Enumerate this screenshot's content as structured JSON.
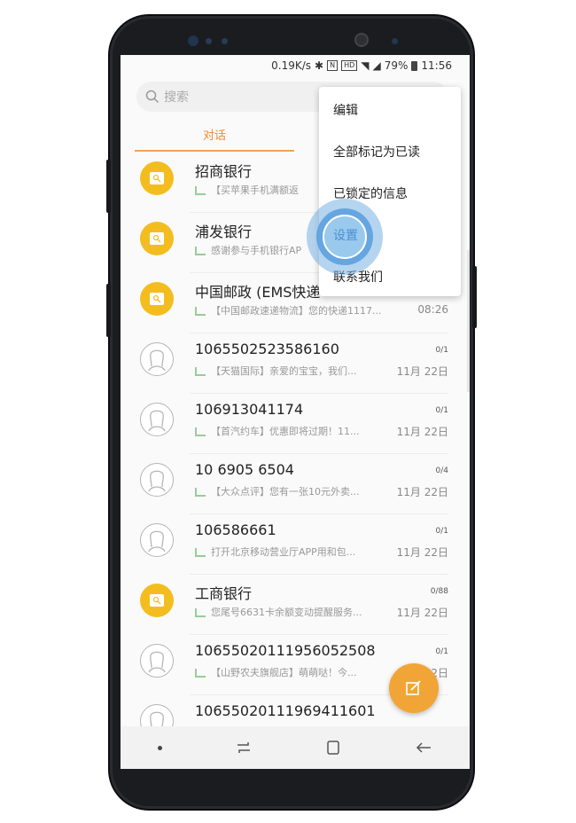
{
  "status_bar": {
    "speed": "0.19K/s",
    "hd": "HD",
    "battery": "79%",
    "time": "11:56"
  },
  "search": {
    "placeholder": "搜索"
  },
  "tabs": {
    "active": "对话"
  },
  "conversations": [
    {
      "name": "招商银行",
      "preview": "【买苹果手机满额返",
      "avatar": "bank",
      "count": "",
      "time": ""
    },
    {
      "name": "浦发银行",
      "preview": "感谢参与手机银行AP",
      "avatar": "bank",
      "count": "",
      "time": ""
    },
    {
      "name": "中国邮政 (EMS快递",
      "preview": "【中国邮政速递物流】您的快递1117...",
      "avatar": "bank",
      "count": "",
      "time": "08:26"
    },
    {
      "name": "1065502523586160",
      "preview": "【天猫国际】亲爱的宝宝，我们...",
      "avatar": "person",
      "count": "0/1",
      "time": "11月 22日"
    },
    {
      "name": "106913041174",
      "preview": "【首汽约车】优惠即将过期！11...",
      "avatar": "person",
      "count": "0/1",
      "time": "11月 22日"
    },
    {
      "name": "10 6905 6504",
      "preview": "【大众点评】您有一张10元外卖...",
      "avatar": "person",
      "count": "0/4",
      "time": "11月 22日"
    },
    {
      "name": "106586661",
      "preview": "打开北京移动营业厅APP用和包...",
      "avatar": "person",
      "count": "0/1",
      "time": "11月 22日"
    },
    {
      "name": "工商银行",
      "preview": "您尾号6631卡余额变动提醒服务...",
      "avatar": "bank",
      "count": "0/88",
      "time": "11月 22日"
    },
    {
      "name": "10655020111956052508",
      "preview": "【山野农夫旗舰店】萌萌哒！今...",
      "avatar": "person",
      "count": "0/1",
      "time": "11月 22日"
    },
    {
      "name": "10655020111969411601",
      "preview": "",
      "avatar": "person",
      "count": "",
      "time": ""
    }
  ],
  "menu": {
    "items": [
      "编辑",
      "全部标记为已读",
      "已锁定的信息",
      "设置",
      "联系我们"
    ],
    "selected": "设置"
  },
  "icons": {
    "search": "search-icon",
    "fab": "compose-icon",
    "nav": [
      "recent-apps-icon",
      "home-icon",
      "back-icon"
    ]
  },
  "colors": {
    "accent": "#f08a2c",
    "bank_avatar": "#f4bd1f",
    "fab": "#f2a537",
    "touch": "#579ede"
  }
}
